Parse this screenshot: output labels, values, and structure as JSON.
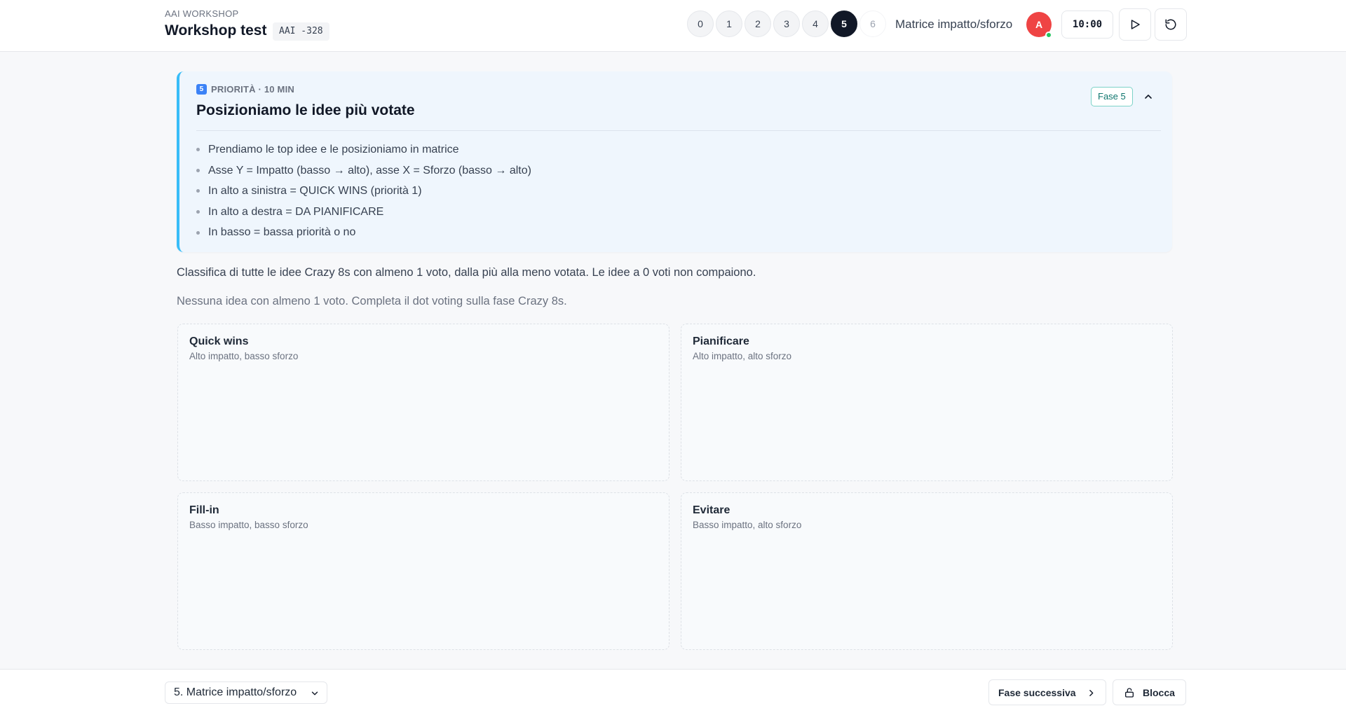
{
  "header": {
    "kicker": "AAI WORKSHOP",
    "title": "Workshop test",
    "code": "AAI -328",
    "steps": [
      "0",
      "1",
      "2",
      "3",
      "4",
      "5",
      "6"
    ],
    "active_step": "5",
    "phase_name": "Matrice impatto/sforzo",
    "avatar_initial": "A",
    "timer": "10:00",
    "play_icon": "play-icon",
    "reset_icon": "reset-icon"
  },
  "phase_card": {
    "step_icon_label": "5",
    "kicker": "PRIORITÀ · 10 MIN",
    "title": "Posizioniamo le idee più votate",
    "badge": "Fase 5",
    "bullets": [
      "Prendiamo le top idee e le posizioniamo in matrice",
      "Asse Y = Impatto (basso → alto), asse X = Sforzo (basso → alto)",
      "In alto a sinistra = QUICK WINS (priorità 1)",
      "In alto a destra = DA PIANIFICARE",
      "In basso = bassa priorità o no"
    ]
  },
  "main": {
    "description": "Classifica di tutte le idee Crazy 8s con almeno 1 voto, dalla più alla meno votata. Le idee a 0 voti non compaiono.",
    "empty_note": "Nessuna idea con almeno 1 voto. Completa il dot voting sulla fase Crazy 8s."
  },
  "matrix": {
    "quick_wins": {
      "title": "Quick wins",
      "subtitle": "Alto impatto, basso sforzo"
    },
    "plan": {
      "title": "Pianificare",
      "subtitle": "Alto impatto, alto sforzo"
    },
    "fill_in": {
      "title": "Fill-in",
      "subtitle": "Basso impatto, basso sforzo"
    },
    "avoid": {
      "title": "Evitare",
      "subtitle": "Basso impatto, alto sforzo"
    }
  },
  "footer": {
    "phase_select": "5. Matrice impatto/sforzo",
    "next_label": "Fase successiva",
    "lock_label": "Blocca"
  },
  "colors": {
    "accent": "#38bdf8",
    "active_step": "#111827",
    "avatar": "#ef4444",
    "online": "#22c55e"
  }
}
